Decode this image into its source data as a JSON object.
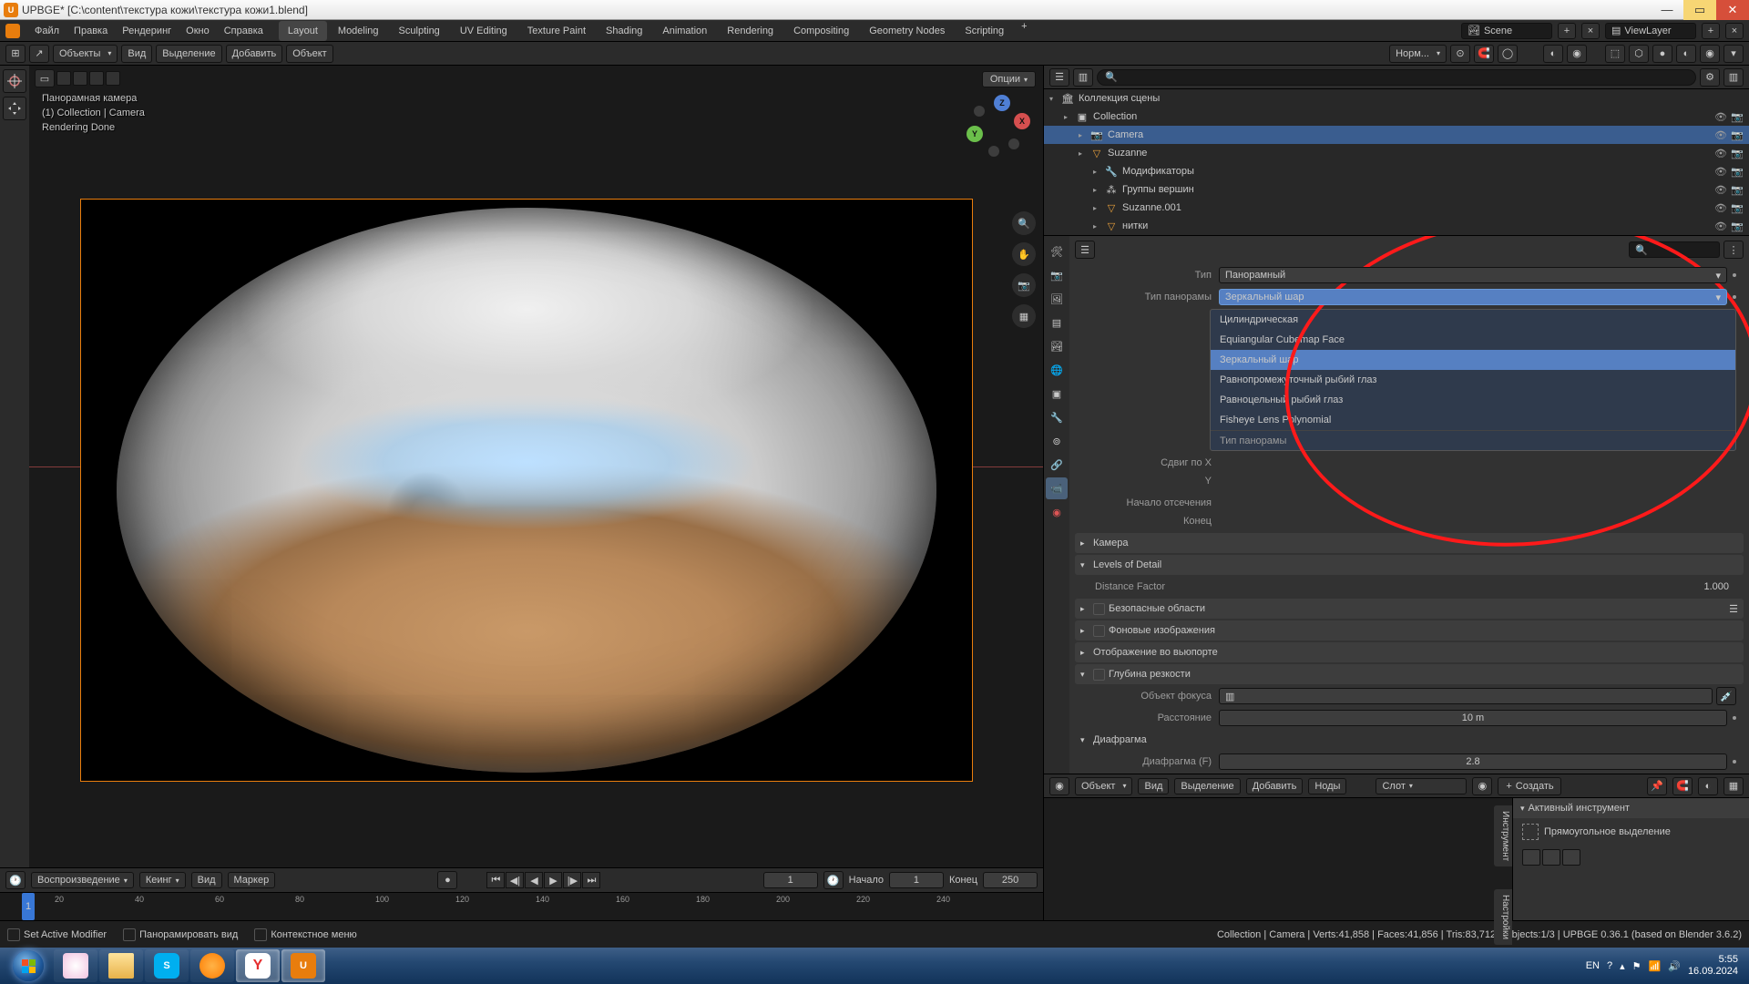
{
  "window": {
    "title": "UPBGE* [C:\\content\\текстура кожи\\текстура кожи1.blend]"
  },
  "menu": {
    "file": "Файл",
    "edit": "Правка",
    "render": "Рендеринг",
    "window": "Окно",
    "help": "Справка"
  },
  "workspaces": {
    "layout": "Layout",
    "modeling": "Modeling",
    "sculpting": "Sculpting",
    "uv": "UV Editing",
    "texpaint": "Texture Paint",
    "shading": "Shading",
    "animation": "Animation",
    "rendering": "Rendering",
    "compositing": "Compositing",
    "geonodes": "Geometry Nodes",
    "scripting": "Scripting"
  },
  "header_right": {
    "scene": "Scene",
    "viewlayer": "ViewLayer"
  },
  "toolbar": {
    "mode": "Объекты",
    "view": "Вид",
    "select": "Выделение",
    "add": "Добавить",
    "object": "Объект",
    "orientation": "Норм...",
    "options": "Опции"
  },
  "viewport": {
    "title": "Панорамная камера",
    "subtitle": "(1) Collection | Camera",
    "status": "Rendering Done"
  },
  "outliner": {
    "root": "Коллекция сцены",
    "items": [
      {
        "name": "Collection",
        "icon": "collection",
        "depth": 1
      },
      {
        "name": "Camera",
        "icon": "camera",
        "depth": 2,
        "selected": true
      },
      {
        "name": "Suzanne",
        "icon": "mesh",
        "depth": 2
      },
      {
        "name": "Модификаторы",
        "icon": "modifier",
        "depth": 3
      },
      {
        "name": "Группы вершин",
        "icon": "vgroup",
        "depth": 3
      },
      {
        "name": "Suzanne.001",
        "icon": "mesh",
        "depth": 3
      },
      {
        "name": "нитки",
        "icon": "mesh",
        "depth": 3
      }
    ]
  },
  "properties": {
    "type_lbl": "Тип",
    "type_val": "Панорамный",
    "pano_lbl": "Тип панорамы",
    "pano_val": "Зеркальный шар",
    "shift_x_lbl": "Сдвиг по X",
    "shift_y_lbl": "Y",
    "clip_start_lbl": "Начало отсечения",
    "clip_end_lbl": "Конец",
    "dd_options": [
      "Цилиндрическая",
      "Equiangular Cubemap Face",
      "Зеркальный шар",
      "Равнопромежуточный рыбий глаз",
      "Равноцельный рыбий глаз",
      "Fisheye Lens Polynomial"
    ],
    "dd_footer": "Тип панорамы",
    "sections": {
      "camera": "Камера",
      "lod": "Levels of Detail",
      "distance": "Distance Factor",
      "distance_val": "1.000",
      "safe": "Безопасные области",
      "bg": "Фоновые изображения",
      "vp": "Отображение во вьюпорте",
      "dof": "Глубина резкости",
      "focus_obj": "Объект фокуса",
      "focus_dist": "Расстояние",
      "focus_dist_val": "10 m",
      "aperture": "Диафрагма",
      "fstop": "Диафрагма (F)",
      "fstop_val": "2.8"
    }
  },
  "timeline": {
    "playback": "Воспроизведение",
    "keying": "Кеинг",
    "view": "Вид",
    "marker": "Маркер",
    "current": "1",
    "start_lbl": "Начало",
    "start": "1",
    "end_lbl": "Конец",
    "end": "250",
    "ticks": [
      "20",
      "40",
      "60",
      "80",
      "100",
      "120",
      "140",
      "160",
      "180",
      "200",
      "220",
      "240"
    ]
  },
  "node_editor": {
    "mode": "Объект",
    "view": "Вид",
    "select": "Выделение",
    "add": "Добавить",
    "nodes": "Ноды",
    "slot": "Слот",
    "create": "Создать",
    "panel_title": "Активный инструмент",
    "tool": "Прямоугольное выделение",
    "vt1": "Инструмент",
    "vt2": "Настройки"
  },
  "statusbar": {
    "i1": "Set Active Modifier",
    "i2": "Панорамировать вид",
    "i3": "Контекстное меню",
    "info": "Collection | Camera | Verts:41,858 | Faces:41,856 | Tris:83,712 | Objects:1/3 | UPBGE 0.36.1 (based on Blender 3.6.2)"
  },
  "taskbar": {
    "lang": "EN",
    "time": "5:55",
    "date": "16.09.2024"
  }
}
